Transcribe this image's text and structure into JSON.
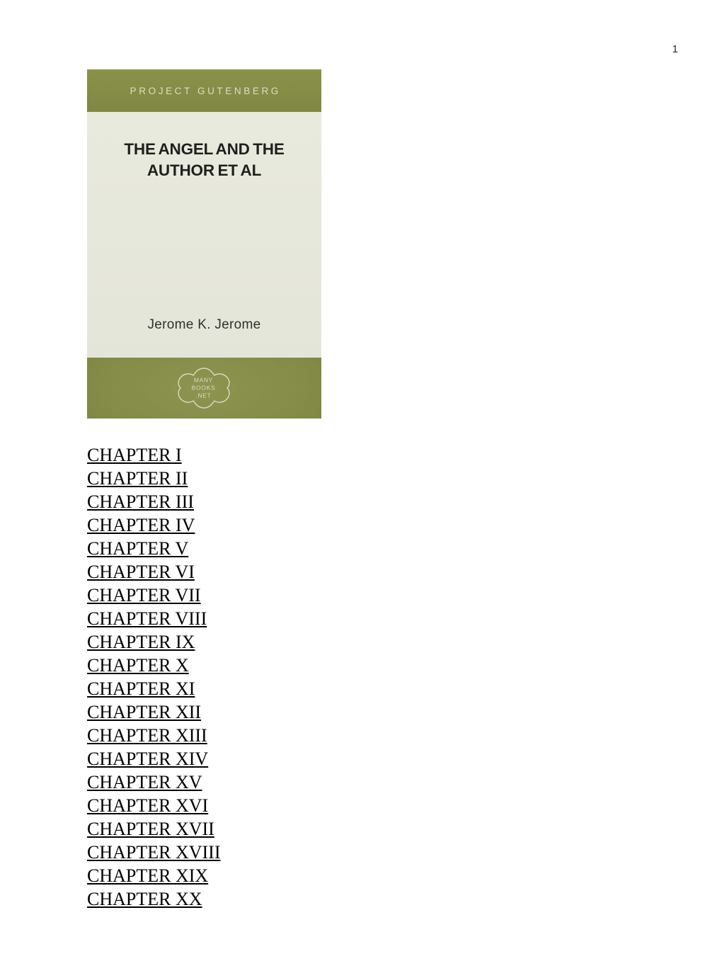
{
  "page": {
    "number": "1",
    "background": "#ffffff"
  },
  "colors": {
    "cover_green": "#8a9149",
    "cover_cream": "#e7e8dd",
    "publisher_text": "#dcdfc6",
    "title_text": "#1f1f1f",
    "link_text": "#000000"
  },
  "cover": {
    "publisher": "PROJECT GUTENBERG",
    "title_lines": [
      "THE ANGEL AND THE",
      "AUTHOR ET AL"
    ],
    "author": "Jerome K. Jerome",
    "logo": {
      "name": "manybooks-net-logo",
      "lines": [
        "MANY",
        "BOOKS",
        ".NET"
      ]
    }
  },
  "contents": {
    "chapters": [
      {
        "label": "CHAPTER I"
      },
      {
        "label": "CHAPTER II"
      },
      {
        "label": "CHAPTER III"
      },
      {
        "label": "CHAPTER IV"
      },
      {
        "label": "CHAPTER V"
      },
      {
        "label": "CHAPTER VI"
      },
      {
        "label": "CHAPTER VII"
      },
      {
        "label": "CHAPTER VIII"
      },
      {
        "label": "CHAPTER IX"
      },
      {
        "label": "CHAPTER X"
      },
      {
        "label": "CHAPTER XI"
      },
      {
        "label": "CHAPTER XII"
      },
      {
        "label": "CHAPTER XIII"
      },
      {
        "label": "CHAPTER XIV"
      },
      {
        "label": "CHAPTER XV"
      },
      {
        "label": "CHAPTER XVI"
      },
      {
        "label": "CHAPTER XVII"
      },
      {
        "label": "CHAPTER XVIII"
      },
      {
        "label": "CHAPTER XIX"
      },
      {
        "label": "CHAPTER XX"
      }
    ]
  }
}
